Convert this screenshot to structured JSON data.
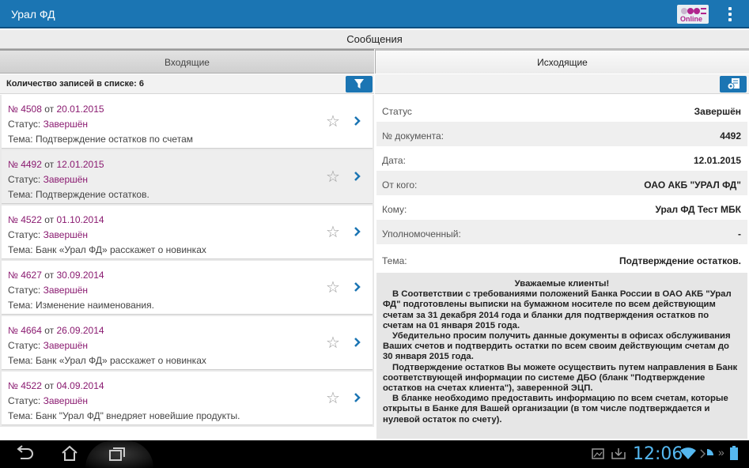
{
  "app": {
    "title": "Урал ФД",
    "logo_text": "Online"
  },
  "header": {
    "title": "Сообщения"
  },
  "tabs": [
    {
      "label": "Входящие"
    },
    {
      "label": "Исходящие"
    }
  ],
  "list": {
    "count_label": "Количество записей в списке: 6",
    "items": [
      {
        "num": "№ 4508",
        "from": "от",
        "date": "20.01.2015",
        "status_label": "Статус:",
        "status": "Завершён",
        "subject_label": "Тема:",
        "subject": "Подтверждение остатков по счетам"
      },
      {
        "num": "№ 4492",
        "from": "от",
        "date": "12.01.2015",
        "status_label": "Статус:",
        "status": "Завершён",
        "subject_label": "Тема:",
        "subject": "Подтверждение остатков."
      },
      {
        "num": "№ 4522",
        "from": "от",
        "date": "01.10.2014",
        "status_label": "Статус:",
        "status": "Завершён",
        "subject_label": "Тема:",
        "subject": "Банк «Урал ФД» расскажет о новинках"
      },
      {
        "num": "№ 4627",
        "from": "от",
        "date": "30.09.2014",
        "status_label": "Статус:",
        "status": "Завершён",
        "subject_label": "Тема:",
        "subject": "Изменение наименования."
      },
      {
        "num": "№ 4664",
        "from": "от",
        "date": "26.09.2014",
        "status_label": "Статус:",
        "status": "Завершён",
        "subject_label": "Тема:",
        "subject": "Банк «Урал ФД» расскажет о новинках"
      },
      {
        "num": "№ 4522",
        "from": "от",
        "date": "04.09.2014",
        "status_label": "Статус:",
        "status": "Завершён",
        "subject_label": "Тема:",
        "subject": "Банк \"Урал ФД\" внедряет новейшие продукты."
      }
    ]
  },
  "details": {
    "rows": [
      {
        "label": "Статус",
        "value": "Завершён"
      },
      {
        "label": "№ документа:",
        "value": "4492"
      },
      {
        "label": "Дата:",
        "value": "12.01.2015"
      },
      {
        "label": "От кого:",
        "value": "ОАО АКБ \"УРАЛ ФД\""
      },
      {
        "label": "Кому:",
        "value": "Урал ФД Тест МБК"
      },
      {
        "label": "Уполномоченный:",
        "value": "-"
      },
      {
        "label": "Тема:",
        "value": "Подтверждение остатков."
      }
    ],
    "letter": {
      "greeting": "Уважаемые клиенты!",
      "p1": "В Соответствии с требованиями положений Банка России в ОАО АКБ \"Урал ФД\" подготовлены выписки на бумажном носителе по всем действующим счетам за 31 декабря 2014 года и бланки для подтверждения остатков по счетам на 01 января 2015 года.",
      "p2": "Убедительно просим получить данные документы в офисах обслуживания Ваших счетов и подтвердить остатки по всем своим действующим счетам до 30 января 2015 года.",
      "p3": "Подтверждение остатков Вы можете осуществить путем направления в Банк соответствующей информации по системе ДБО (бланк \"Подтверждение остатков на счетах клиента\"), заверенной ЭЦП.",
      "p4": "В бланке необходимо предоставить информацию по всем счетам, которые открыты в Банке для Вашей организации (в том числе подтверждается и нулевой остаток по счету)."
    }
  },
  "system": {
    "time": "12:06"
  },
  "colors": {
    "accent": "#1b75b3",
    "purple": "#8a1a70",
    "clock": "#55b8f0"
  }
}
